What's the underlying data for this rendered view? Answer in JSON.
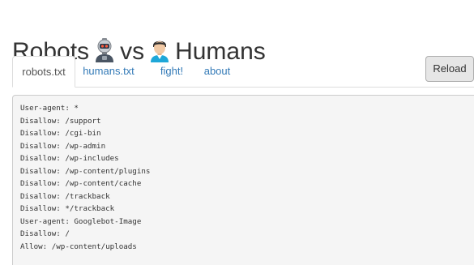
{
  "header": {
    "word_robots": "Robots",
    "word_vs": "vs",
    "word_humans": "Humans",
    "robot_icon": "robot-icon",
    "human_icon": "human-icon"
  },
  "tabs": [
    {
      "label": "robots.txt",
      "active": true
    },
    {
      "label": "humans.txt",
      "active": false
    },
    {
      "label": "fight!",
      "active": false
    },
    {
      "label": "about",
      "active": false
    }
  ],
  "reload_label": "Reload",
  "code_lines": [
    "User-agent: *",
    "Disallow: /support",
    "Disallow: /cgi-bin",
    "Disallow: /wp-admin",
    "Disallow: /wp-includes",
    "Disallow: /wp-content/plugins",
    "Disallow: /wp-content/cache",
    "Disallow: /trackback",
    "Disallow: */trackback",
    "User-agent: Googlebot-Image",
    "Disallow: /",
    "Allow: /wp-content/uploads"
  ]
}
